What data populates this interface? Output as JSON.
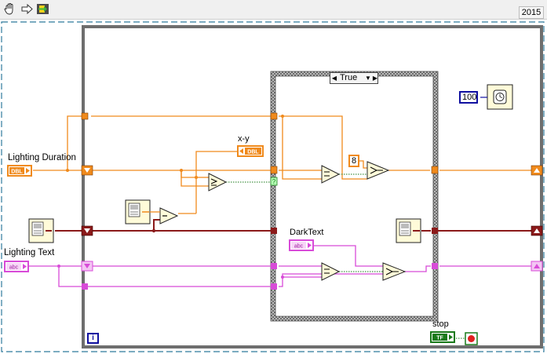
{
  "toolbar": {
    "tools": [
      "hand-icon",
      "step-arrow-icon",
      "highlight-execution-icon"
    ],
    "version": "2015"
  },
  "diagram": {
    "case_selector_value": "True",
    "labels": {
      "lighting_duration": "Lighting Duration",
      "lighting_text": "Lighting Text",
      "x_minus_y": "x-y",
      "dark_text": "DarkText",
      "stop": "stop"
    },
    "terminals": {
      "dbl": "DBL",
      "abc": "abc",
      "tf": "TF"
    },
    "constants": {
      "wait_ms": "100",
      "select_index": "8"
    },
    "loop_iteration": "i",
    "colors": {
      "numeric_wire": "#f08a1c",
      "string_wire": "#d84bd8",
      "refnum_wire": "#8b1a1a",
      "loop_border": "#6e6e6e",
      "boolean_wire": "#1a7a1a"
    }
  }
}
